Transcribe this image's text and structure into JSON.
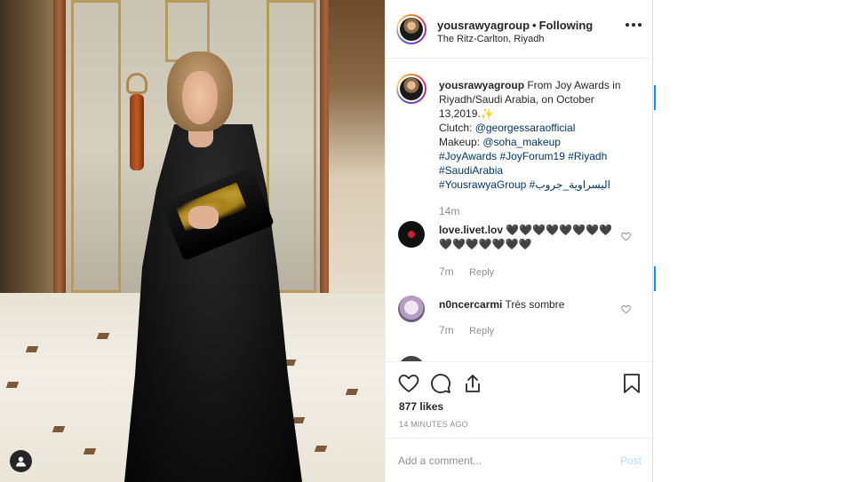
{
  "post": {
    "username": "yousrawyagroup",
    "separator": "•",
    "follow_status": "Following",
    "location": "The Ritz-Carlton, Riyadh"
  },
  "caption": {
    "username": "yousrawyagroup",
    "text_1": "From Joy Awards in Riyadh/Saudi Arabia, on October 13,2019.✨",
    "clutch_label": "Clutch:",
    "clutch_handle": "@georgessaraofficial",
    "makeup_label": "Makeup:",
    "makeup_handle": "@soha_makeup",
    "tag_1": "#JoyAwards",
    "tag_2": "#JoyForum19",
    "tag_3": "#Riyadh",
    "tag_4": "#SaudiArabia",
    "tag_5": "#YousrawyaGroup",
    "tag_6": "#اليسراوية_جروب",
    "time": "14m"
  },
  "comments": [
    {
      "username": "love.livet.lov",
      "text": "🖤🖤🖤🖤🖤🖤🖤🖤🖤🖤🖤🖤🖤🖤🖤",
      "time": "7m",
      "reply": "Reply"
    },
    {
      "username": "n0ncercarmi",
      "text": "Très sombre",
      "time": "7m",
      "reply": "Reply"
    }
  ],
  "engagement": {
    "likes": "877 likes",
    "posted": "14 MINUTES AGO"
  },
  "add_comment": {
    "placeholder": "Add a comment...",
    "post_label": "Post"
  },
  "colors": {
    "link": "#003569",
    "muted": "#8e8e8e",
    "post_disabled": "#b2dffc"
  },
  "icons": [
    "user-tag-icon",
    "more-options-icon",
    "heart-icon",
    "comment-icon",
    "share-icon",
    "bookmark-icon"
  ]
}
